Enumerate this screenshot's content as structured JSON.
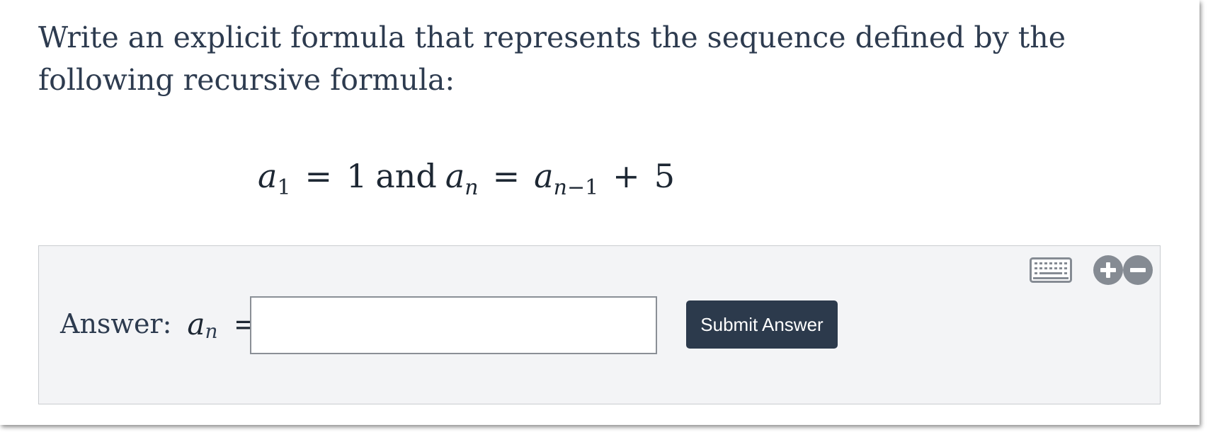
{
  "question": {
    "text": "Write an explicit formula that represents the sequence defined by the following recursive formula:"
  },
  "formula": {
    "a1_var": "a",
    "a1_sub": "1",
    "eq1": "=",
    "a1_value": "1",
    "and": "and",
    "an_var": "a",
    "an_sub": "n",
    "eq2": "=",
    "rhs_var": "a",
    "rhs_sub_var": "n",
    "rhs_sub_rest": "−1",
    "plus": "+",
    "rhs_const": "5"
  },
  "answer": {
    "label": "Answer:",
    "var": "a",
    "sub": "n",
    "eq": "=",
    "input_value": "",
    "submit_label": "Submit Answer"
  },
  "tools": {
    "keyboard_icon": "keyboard-icon",
    "zoom_in_icon": "plus-circle-icon",
    "zoom_out_icon": "minus-circle-icon"
  }
}
